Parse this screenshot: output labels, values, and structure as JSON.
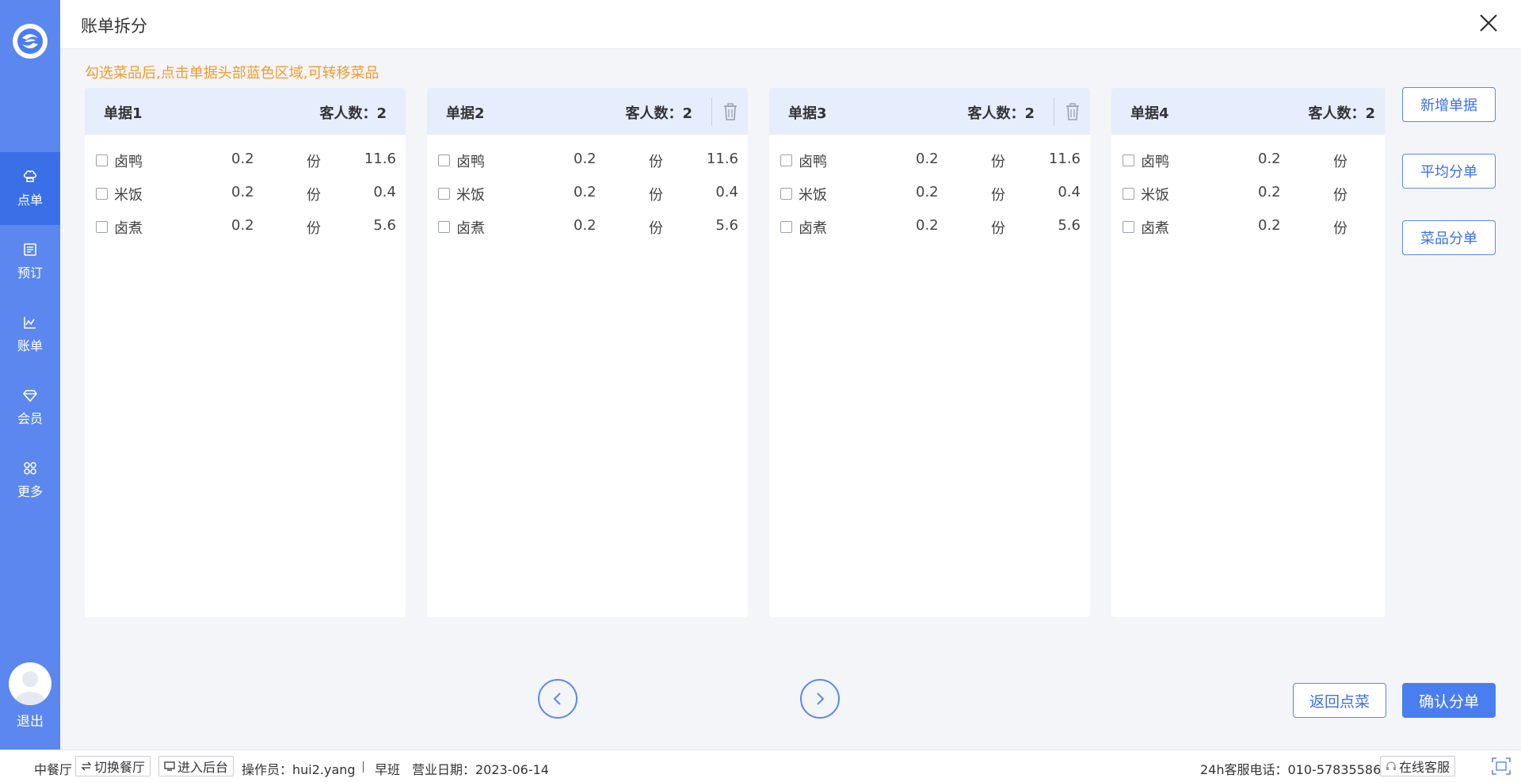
{
  "sidebar": {
    "nav": [
      {
        "label": "点单",
        "icon": "chef-hat-icon",
        "active": true
      },
      {
        "label": "预订",
        "icon": "book-icon",
        "active": false
      },
      {
        "label": "账单",
        "icon": "chart-icon",
        "active": false
      },
      {
        "label": "会员",
        "icon": "diamond-icon",
        "active": false
      },
      {
        "label": "更多",
        "icon": "grid-icon",
        "active": false
      }
    ],
    "logout": "退出"
  },
  "header": {
    "title": "账单拆分"
  },
  "hint": "勾选菜品后,点击单据头部蓝色区域,可转移菜品",
  "bills": [
    {
      "name": "单据1",
      "guest_label": "客人数：2",
      "deletable": false,
      "items": [
        {
          "name": "卤鸭",
          "qty": "0.2",
          "unit": "份",
          "price": "11.6"
        },
        {
          "name": "米饭",
          "qty": "0.2",
          "unit": "份",
          "price": "0.4"
        },
        {
          "name": "卤煮",
          "qty": "0.2",
          "unit": "份",
          "price": "5.6"
        }
      ]
    },
    {
      "name": "单据2",
      "guest_label": "客人数：2",
      "deletable": true,
      "items": [
        {
          "name": "卤鸭",
          "qty": "0.2",
          "unit": "份",
          "price": "11.6"
        },
        {
          "name": "米饭",
          "qty": "0.2",
          "unit": "份",
          "price": "0.4"
        },
        {
          "name": "卤煮",
          "qty": "0.2",
          "unit": "份",
          "price": "5.6"
        }
      ]
    },
    {
      "name": "单据3",
      "guest_label": "客人数：2",
      "deletable": true,
      "items": [
        {
          "name": "卤鸭",
          "qty": "0.2",
          "unit": "份",
          "price": "11.6"
        },
        {
          "name": "米饭",
          "qty": "0.2",
          "unit": "份",
          "price": "0.4"
        },
        {
          "name": "卤煮",
          "qty": "0.2",
          "unit": "份",
          "price": "5.6"
        }
      ]
    },
    {
      "name": "单据4",
      "guest_label": "客人数：2",
      "deletable": false,
      "items": [
        {
          "name": "卤鸭",
          "qty": "0.2",
          "unit": "份",
          "price": ""
        },
        {
          "name": "米饭",
          "qty": "0.2",
          "unit": "份",
          "price": ""
        },
        {
          "name": "卤煮",
          "qty": "0.2",
          "unit": "份",
          "price": ""
        }
      ]
    }
  ],
  "actions": {
    "add_bill": "新增单据",
    "average_split": "平均分单",
    "dish_split": "菜品分单",
    "back": "返回点菜",
    "confirm": "确认分单"
  },
  "status": {
    "restaurant": "中餐厅",
    "switch_restaurant": "切换餐厅",
    "enter_backend": "进入后台",
    "operator": "操作员：hui2.yang",
    "shift": "早班",
    "business_date": "营业日期：2023-06-14",
    "hotline": "24h客服电话：010-57835586",
    "online_service": "在线客服"
  },
  "colors": {
    "sidebar": "#5b87ee",
    "sidebar_active": "#3b6fe8",
    "panel_header": "#e6edfd",
    "hint": "#f39a2b",
    "primary": "#4a7ef0"
  }
}
